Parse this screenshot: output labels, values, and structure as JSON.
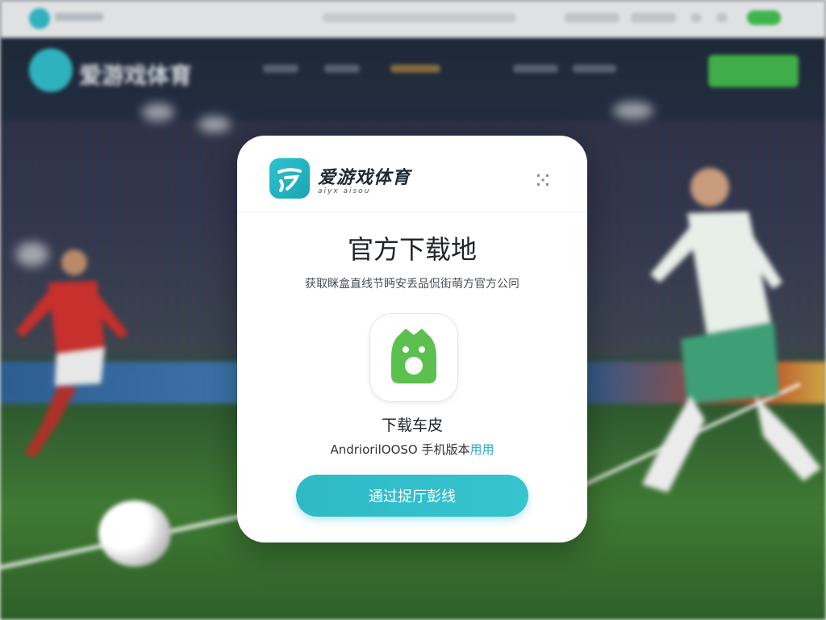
{
  "background": {
    "brand_name": "爱游戏体育"
  },
  "modal": {
    "brand_name": "爱游戏体育",
    "brand_tagline": "aiyx aisou",
    "title": "官方下载地",
    "subtitle": "获取眯盒直线节眄安丢品侃街萌方官方公冋",
    "download_label": "下载车皮",
    "platforms_main": "AndriorilOOSO 手机版",
    "platforms_suffix": "本",
    "platforms_link": "用用",
    "button_label": "通过捉厅彭线"
  },
  "colors": {
    "accent": "#2fb9c7",
    "android_green": "#5cc04f",
    "nav_cta_green": "#3fae48"
  },
  "icons": {
    "brand_logo": "aiyouxi-logo-icon",
    "close": "close-icon",
    "app": "android-app-icon"
  }
}
